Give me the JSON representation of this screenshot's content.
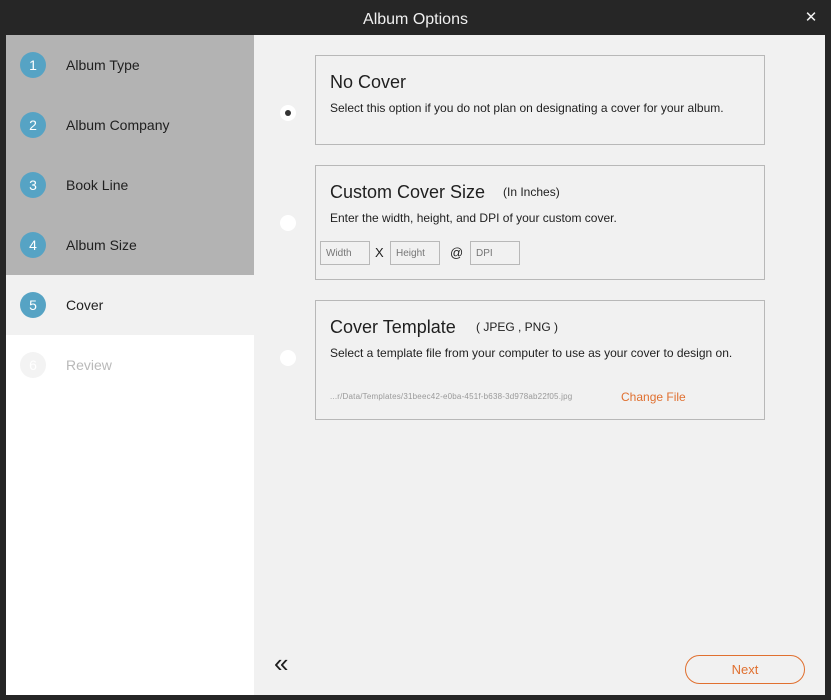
{
  "window": {
    "title": "Album Options",
    "close_icon": "close-icon"
  },
  "steps": [
    {
      "num": "1",
      "label": "Album Type"
    },
    {
      "num": "2",
      "label": "Album Company"
    },
    {
      "num": "3",
      "label": "Book Line"
    },
    {
      "num": "4",
      "label": "Album Size"
    },
    {
      "num": "5",
      "label": "Cover"
    },
    {
      "num": "6",
      "label": "Review"
    }
  ],
  "current_step": 5,
  "options": {
    "no_cover": {
      "title": "No Cover",
      "description": "Select this option if you do not plan on designating a cover for your album.",
      "selected": true
    },
    "custom_size": {
      "title": "Custom Cover Size",
      "subtitle": "(In Inches)",
      "description": "Enter the width, height, and DPI of your custom cover.",
      "width_placeholder": "Width",
      "height_placeholder": "Height",
      "dpi_placeholder": "DPI",
      "times_sign": "X",
      "at_sign": "@",
      "selected": false
    },
    "template": {
      "title": "Cover Template",
      "subtitle": "( JPEG , PNG )",
      "description": "Select a template file from your computer to use as your cover to design on.",
      "file_path": "...r/Data/Templates/31beec42-e0ba-451f-b638-3d978ab22f05.jpg",
      "change_label": "Change File",
      "selected": false
    }
  },
  "footer": {
    "back_icon": "double-chevron-left-icon",
    "next_label": "Next"
  },
  "colors": {
    "accent": "#e07030",
    "step_badge": "#56a3c4",
    "sidebar_done": "#b3b3b3",
    "content_bg": "#f1f1f1"
  }
}
